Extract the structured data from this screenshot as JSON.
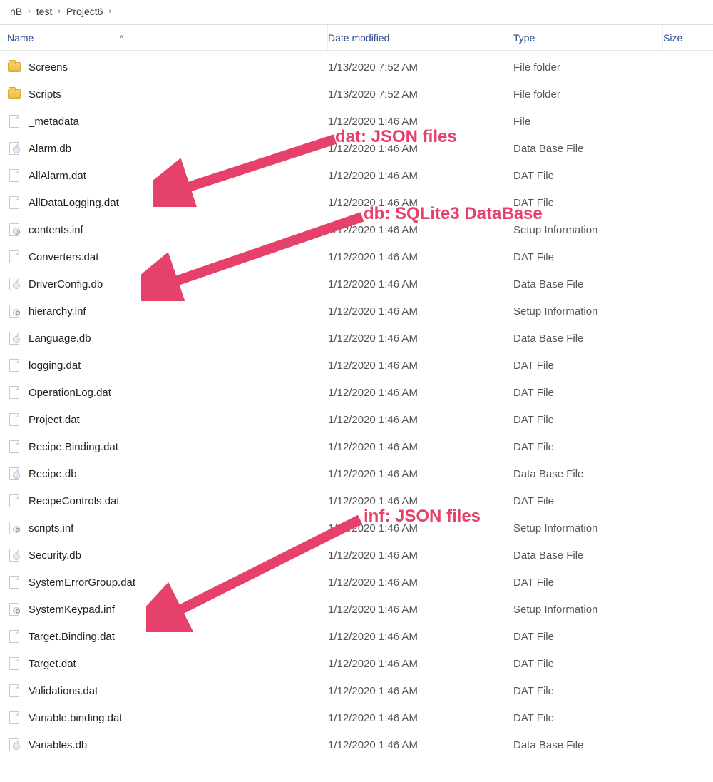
{
  "breadcrumb": {
    "parts": [
      "nB",
      "test",
      "Project6"
    ]
  },
  "columns": {
    "name": "Name",
    "date": "Date modified",
    "type": "Type",
    "size": "Size"
  },
  "files": [
    {
      "icon": "folder",
      "name": "Screens",
      "date": "1/13/2020 7:52 AM",
      "type": "File folder"
    },
    {
      "icon": "folder",
      "name": "Scripts",
      "date": "1/13/2020 7:52 AM",
      "type": "File folder"
    },
    {
      "icon": "file",
      "name": "_metadata",
      "date": "1/12/2020 1:46 AM",
      "type": "File"
    },
    {
      "icon": "db",
      "name": "Alarm.db",
      "date": "1/12/2020 1:46 AM",
      "type": "Data Base File"
    },
    {
      "icon": "file",
      "name": "AllAlarm.dat",
      "date": "1/12/2020 1:46 AM",
      "type": "DAT File"
    },
    {
      "icon": "file",
      "name": "AllDataLogging.dat",
      "date": "1/12/2020 1:46 AM",
      "type": "DAT File"
    },
    {
      "icon": "inf",
      "name": "contents.inf",
      "date": "1/12/2020 1:46 AM",
      "type": "Setup Information"
    },
    {
      "icon": "file",
      "name": "Converters.dat",
      "date": "1/12/2020 1:46 AM",
      "type": "DAT File"
    },
    {
      "icon": "db",
      "name": "DriverConfig.db",
      "date": "1/12/2020 1:46 AM",
      "type": "Data Base File"
    },
    {
      "icon": "inf",
      "name": "hierarchy.inf",
      "date": "1/12/2020 1:46 AM",
      "type": "Setup Information"
    },
    {
      "icon": "db",
      "name": "Language.db",
      "date": "1/12/2020 1:46 AM",
      "type": "Data Base File"
    },
    {
      "icon": "file",
      "name": "logging.dat",
      "date": "1/12/2020 1:46 AM",
      "type": "DAT File"
    },
    {
      "icon": "file",
      "name": "OperationLog.dat",
      "date": "1/12/2020 1:46 AM",
      "type": "DAT File"
    },
    {
      "icon": "file",
      "name": "Project.dat",
      "date": "1/12/2020 1:46 AM",
      "type": "DAT File"
    },
    {
      "icon": "file",
      "name": "Recipe.Binding.dat",
      "date": "1/12/2020 1:46 AM",
      "type": "DAT File"
    },
    {
      "icon": "db",
      "name": "Recipe.db",
      "date": "1/12/2020 1:46 AM",
      "type": "Data Base File"
    },
    {
      "icon": "file",
      "name": "RecipeControls.dat",
      "date": "1/12/2020 1:46 AM",
      "type": "DAT File"
    },
    {
      "icon": "inf",
      "name": "scripts.inf",
      "date": "1/12/2020 1:46 AM",
      "type": "Setup Information"
    },
    {
      "icon": "db",
      "name": "Security.db",
      "date": "1/12/2020 1:46 AM",
      "type": "Data Base File"
    },
    {
      "icon": "file",
      "name": "SystemErrorGroup.dat",
      "date": "1/12/2020 1:46 AM",
      "type": "DAT File"
    },
    {
      "icon": "inf",
      "name": "SystemKeypad.inf",
      "date": "1/12/2020 1:46 AM",
      "type": "Setup Information"
    },
    {
      "icon": "file",
      "name": "Target.Binding.dat",
      "date": "1/12/2020 1:46 AM",
      "type": "DAT File"
    },
    {
      "icon": "file",
      "name": "Target.dat",
      "date": "1/12/2020 1:46 AM",
      "type": "DAT File"
    },
    {
      "icon": "file",
      "name": "Validations.dat",
      "date": "1/12/2020 1:46 AM",
      "type": "DAT File"
    },
    {
      "icon": "file",
      "name": "Variable.binding.dat",
      "date": "1/12/2020 1:46 AM",
      "type": "DAT File"
    },
    {
      "icon": "db",
      "name": "Variables.db",
      "date": "1/12/2020 1:46 AM",
      "type": "Data Base File"
    }
  ],
  "annotations": {
    "dat": "dat: JSON files",
    "db": "db: SQLite3 DataBase",
    "inf": "inf: JSON files"
  }
}
